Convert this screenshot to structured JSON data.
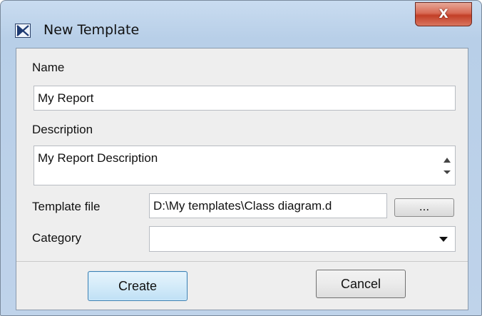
{
  "window": {
    "title": "New Template",
    "close_label": "X"
  },
  "form": {
    "name_label": "Name",
    "name_value": "My Report",
    "description_label": "Description",
    "description_value": "My Report Description",
    "template_file_label": "Template file",
    "template_file_value": "D:\\My templates\\Class diagram.d",
    "browse_label": "...",
    "category_label": "Category",
    "category_value": ""
  },
  "buttons": {
    "create_label": "Create",
    "cancel_label": "Cancel"
  },
  "colors": {
    "title_bar": "#bfd3ea",
    "close_button": "#c8432a",
    "client_background": "#eeeeee",
    "default_button": "#bfe0f5"
  }
}
